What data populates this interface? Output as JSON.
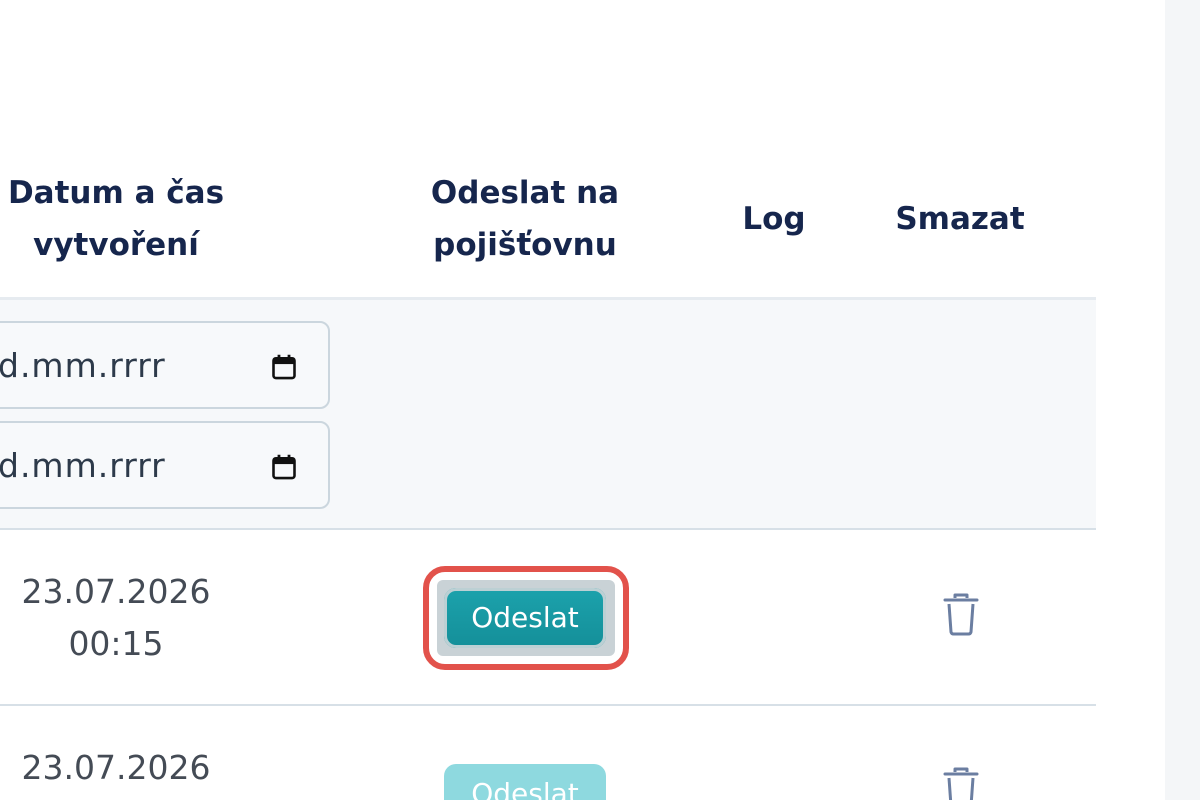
{
  "table": {
    "headers": {
      "created": "Datum a čas\nvytvoření",
      "created_line1": "Datum a čas",
      "created_line2": "vytvoření",
      "send_line1": "Odeslat na",
      "send_line2": "pojišťovnu",
      "log": "Log",
      "delete": "Smazat"
    },
    "filters": {
      "date_from_placeholder": "d.mm.rrrr",
      "date_to_placeholder": "d.mm.rrrr",
      "icon": "calendar-icon"
    },
    "rows": [
      {
        "date": "23.07.2026",
        "time": "00:15",
        "send_label": "Odeslat",
        "send_enabled": true,
        "delete_icon": "trash-icon"
      },
      {
        "date": "23.07.2026",
        "time": "",
        "send_label": "Odeslat",
        "send_enabled": false,
        "delete_icon": "trash-icon"
      }
    ]
  },
  "colors": {
    "header_text": "#16264d",
    "button_primary": "#1699a3",
    "button_disabled": "#8ed9df",
    "highlight": "#e2524b"
  }
}
